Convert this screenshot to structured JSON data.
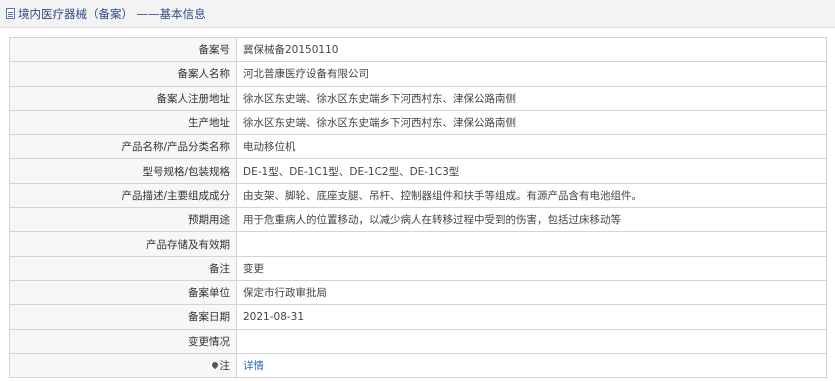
{
  "header": {
    "title": "境内医疗器械（备案） ——基本信息"
  },
  "rows": [
    {
      "label": "备案号",
      "value": "冀保械备20150110"
    },
    {
      "label": "备案人名称",
      "value": "河北普康医疗设备有限公司"
    },
    {
      "label": "备案人注册地址",
      "value": "徐水区东史端、徐水区东史端乡下河西村东、津保公路南侧"
    },
    {
      "label": "生产地址",
      "value": "徐水区东史端、徐水区东史端乡下河西村东、津保公路南侧"
    },
    {
      "label": "产品名称/产品分类名称",
      "value": "电动移位机"
    },
    {
      "label": "型号规格/包装规格",
      "value": "DE-1型、DE-1C1型、DE-1C2型、DE-1C3型"
    },
    {
      "label": "产品描述/主要组成成分",
      "value": "由支架、脚轮、底座支腿、吊杆、控制器组件和扶手等组成。有源产品含有电池组件。"
    },
    {
      "label": "预期用途",
      "value": "用于危重病人的位置移动，以减少病人在转移过程中受到的伤害，包括过床移动等"
    },
    {
      "label": "产品存储及有效期",
      "value": ""
    },
    {
      "label": "备注",
      "value": "变更"
    },
    {
      "label": "备案单位",
      "value": "保定市行政审批局"
    },
    {
      "label": "备案日期",
      "value": "2021-08-31"
    },
    {
      "label": "变更情况",
      "value": ""
    }
  ],
  "note": {
    "label": "注",
    "link": "详情"
  }
}
